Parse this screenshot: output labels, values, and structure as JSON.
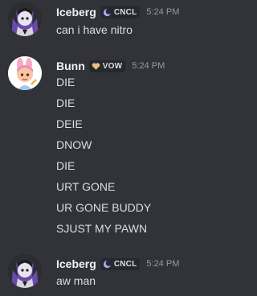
{
  "messages": [
    {
      "author": "Iceberg",
      "tag": "CNCL",
      "time": "5:24 PM",
      "lines": [
        "can i have nitro"
      ]
    },
    {
      "author": "Bunn",
      "tag": "VOW",
      "time": "5:24 PM",
      "lines": [
        "DIE",
        "DIE",
        "DEIE",
        "DNOW",
        "DIE",
        "URT GONE",
        "UR GONE BUDDY",
        "SJUST MY PAWN"
      ]
    },
    {
      "author": "Iceberg",
      "tag": "CNCL",
      "time": "5:24 PM",
      "lines": [
        "aw man"
      ]
    }
  ],
  "colors": {
    "background": "#313338",
    "username": "#f2f3f5",
    "text": "#dbdee1",
    "timestamp": "#949ba4",
    "cncl_icon": "#b0a4f5",
    "vow_icon": "#f0c073"
  },
  "icons": {
    "cncl": "crescent-moon-icon",
    "vow": "heart-icon"
  }
}
